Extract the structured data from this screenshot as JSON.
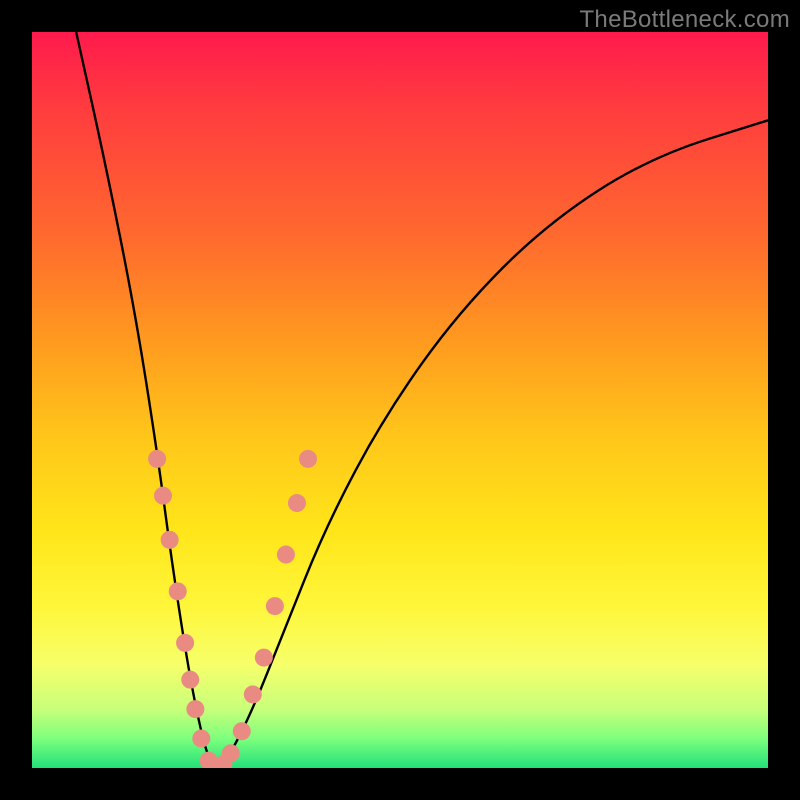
{
  "watermark": {
    "text": "TheBottleneck.com"
  },
  "chart_data": {
    "type": "line",
    "title": "",
    "xlabel": "",
    "ylabel": "",
    "xlim": [
      0,
      100
    ],
    "ylim": [
      0,
      100
    ],
    "grid": false,
    "legend": false,
    "background_gradient": {
      "top_color": "#ff1a4d",
      "bottom_color": "#23e07a",
      "meaning": "red (high) to green (low) mismatch"
    },
    "series": [
      {
        "name": "bottleneck-curve",
        "color": "#000000",
        "x": [
          6,
          10,
          14,
          17,
          19,
          21,
          22.5,
          24,
          25.5,
          27,
          30,
          34,
          40,
          48,
          58,
          70,
          84,
          100
        ],
        "values": [
          100,
          82,
          62,
          43,
          28,
          15,
          7,
          1,
          0,
          2,
          8,
          18,
          33,
          48,
          62,
          74,
          83,
          88
        ]
      }
    ],
    "markers": [
      {
        "name": "left-branch-dots",
        "color": "#e98b83",
        "radius": 9,
        "points": [
          {
            "x": 17.0,
            "y": 42
          },
          {
            "x": 17.8,
            "y": 37
          },
          {
            "x": 18.7,
            "y": 31
          },
          {
            "x": 19.8,
            "y": 24
          },
          {
            "x": 20.8,
            "y": 17
          },
          {
            "x": 21.5,
            "y": 12
          },
          {
            "x": 22.2,
            "y": 8
          },
          {
            "x": 23.0,
            "y": 4
          },
          {
            "x": 24.0,
            "y": 1
          },
          {
            "x": 25.0,
            "y": 0
          },
          {
            "x": 26.0,
            "y": 0.5
          }
        ]
      },
      {
        "name": "right-branch-dots",
        "color": "#e98b83",
        "radius": 9,
        "points": [
          {
            "x": 27.0,
            "y": 2
          },
          {
            "x": 28.5,
            "y": 5
          },
          {
            "x": 30.0,
            "y": 10
          },
          {
            "x": 31.5,
            "y": 15
          },
          {
            "x": 33.0,
            "y": 22
          },
          {
            "x": 34.5,
            "y": 29
          },
          {
            "x": 36.0,
            "y": 36
          },
          {
            "x": 37.5,
            "y": 42
          }
        ]
      }
    ]
  }
}
